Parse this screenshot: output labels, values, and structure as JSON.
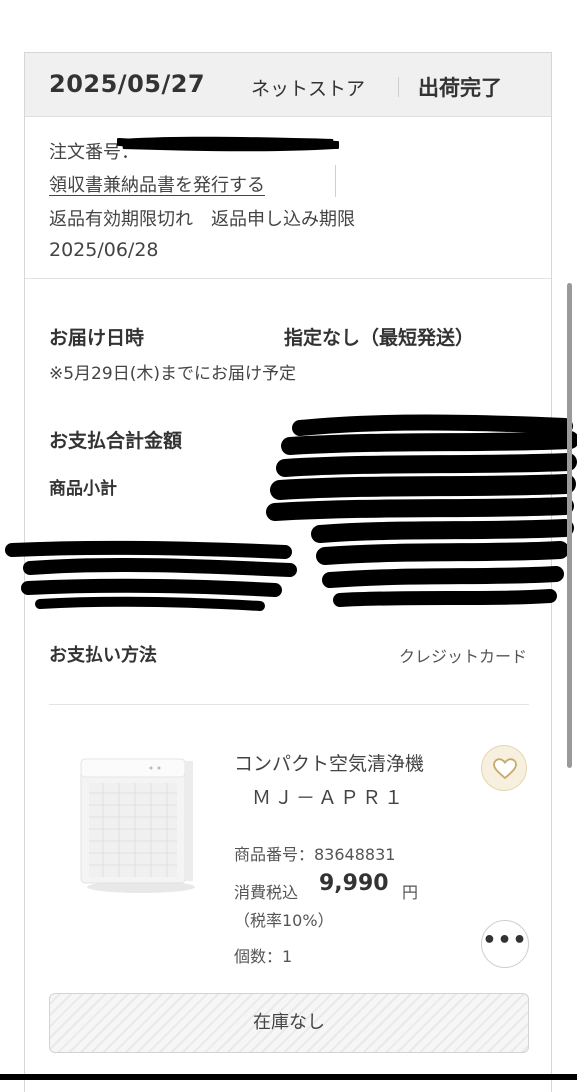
{
  "order": {
    "date": "2025/05/27",
    "store": "ネットストア",
    "status": "出荷完了",
    "number_label": "注文番号：",
    "receipt_link": "領収書兼納品書を発行する",
    "return_note": "返品有効期限切れ　返品申し込み期限",
    "return_deadline": "2025/06/28"
  },
  "delivery": {
    "label": "お届け日時",
    "value": "指定なし（最短発送）",
    "note": "※5月29日(木)までにお届け予定"
  },
  "payment": {
    "total_label": "お支払合計金額",
    "subtotal_label": "商品小計",
    "method_label": "お支払い方法",
    "method_value": "クレジットカード"
  },
  "product": {
    "name_line1": "コンパクト空気清浄機",
    "name_line2": "ＭＪ－ＡＰＲ１",
    "number": "商品番号：83648831",
    "price_label": "消費税込",
    "price": "9,990",
    "price_unit": "円",
    "tax_rate": "（税率10%）",
    "quantity": "個数：1",
    "stock_button": "在庫なし",
    "more_button": "•••"
  },
  "icons": {
    "favorite": "heart-icon",
    "more": "more-icon"
  },
  "colors": {
    "header_bg": "#f0f0f0",
    "favorite_bg": "#f7f0df",
    "favorite_icon": "#c9a86a",
    "redaction": "#000000"
  }
}
